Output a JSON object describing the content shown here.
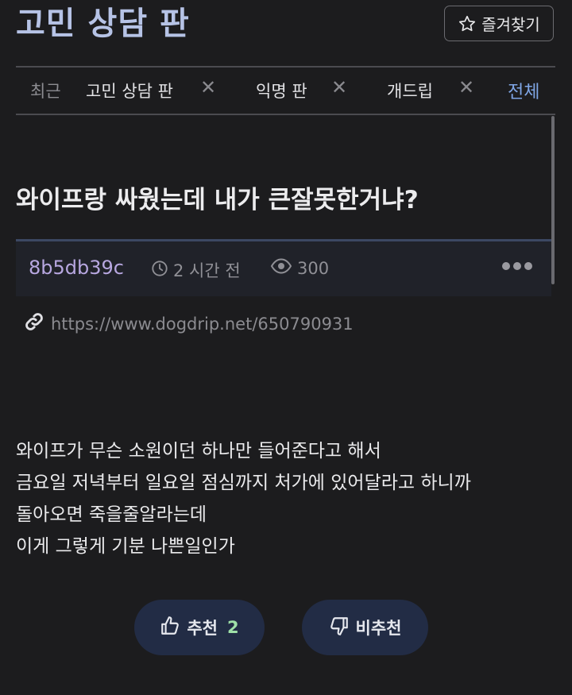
{
  "header": {
    "board_title": "고민 상담 판",
    "favorite_label": "즐겨찾기"
  },
  "tabs": {
    "recent_label": "최근",
    "items": [
      {
        "label": "고민 상담 판"
      },
      {
        "label": "익명 판"
      },
      {
        "label": "개드립"
      }
    ],
    "all_label": "전체"
  },
  "post": {
    "title": "와이프랑 싸웠는데 내가 큰잘못한거냐?",
    "author": "8b5db39c",
    "time": "2 시간 전",
    "views": "300",
    "url": "https://www.dogdrip.net/650790931",
    "body_lines": [
      "와이프가 무슨 소원이던 하나만 들어준다고 해서",
      "금요일 저녁부터 일요일 점심까지 처가에 있어달라고 하니까",
      "돌아오면 죽을줄알라는데",
      "이게 그렇게 기분 나쁜일인가"
    ]
  },
  "votes": {
    "upvote_label": "추천",
    "upvote_count": "2",
    "downvote_label": "비추천"
  },
  "icons": {
    "favorite": "star-outline-icon",
    "tab_close": "x-icon",
    "time": "clock-icon",
    "views": "eye-icon",
    "more": "more-dots-icon",
    "link": "link-icon",
    "upvote": "thumbs-up-icon",
    "downvote": "thumbs-down-icon"
  },
  "colors": {
    "background": "#1c1c1e",
    "board_title": "#b6c3e6",
    "accent_link": "#7fa6e6",
    "author": "#b7a7e0",
    "vote_button_bg": "#222c45",
    "upvote_count": "#9fe0a8"
  }
}
